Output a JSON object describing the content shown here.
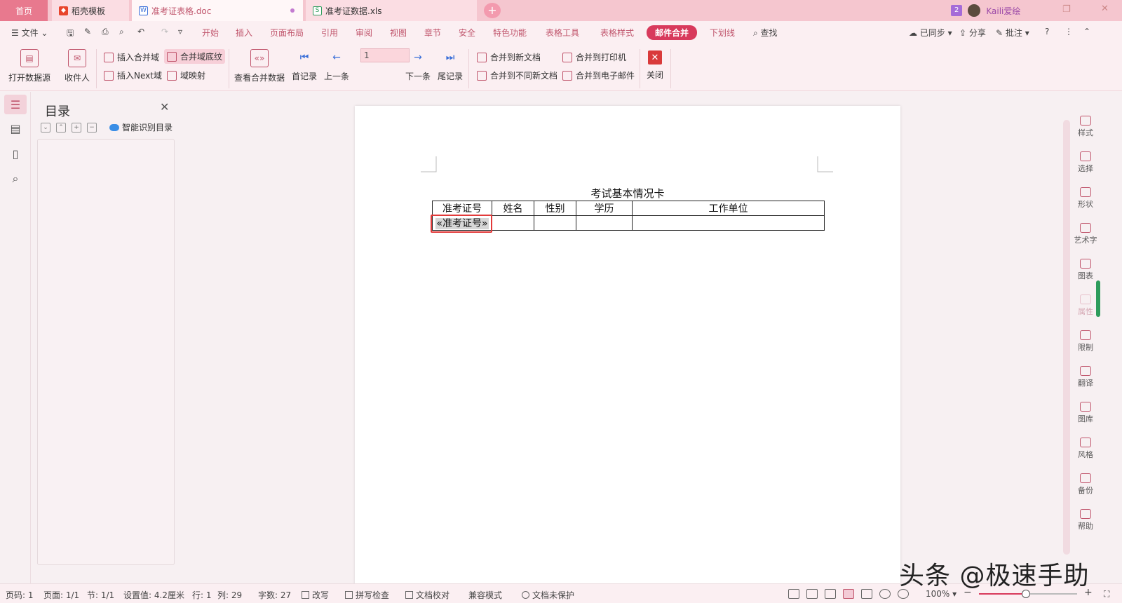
{
  "tabs": [
    {
      "label": "首页"
    },
    {
      "label": "稻壳模板"
    },
    {
      "label": "准考证表格.doc"
    },
    {
      "label": "准考证数据.xls"
    }
  ],
  "account": {
    "badge_count": "2",
    "username": "Kaili爱绘"
  },
  "menu": {
    "file": "文件",
    "tabs": [
      "开始",
      "插入",
      "页面布局",
      "引用",
      "审阅",
      "视图",
      "章节",
      "安全",
      "特色功能",
      "表格工具",
      "表格样式",
      "邮件合并",
      "下划线"
    ],
    "search": "查找",
    "right": [
      "已同步",
      "分享",
      "批注"
    ]
  },
  "ribbon": {
    "open_source": "打开数据源",
    "recipients": "收件人",
    "insert_field": "插入合并域",
    "field_shading": "合并域底纹",
    "insert_next": "插入Next域",
    "field_map": "域映射",
    "view_data": "查看合并数据",
    "first": "首记录",
    "prev": "上一条",
    "record_value": "1",
    "next": "下一条",
    "last": "尾记录",
    "to_new_doc": "合并到新文档",
    "to_diff_docs": "合并到不同新文档",
    "to_printer": "合并到打印机",
    "to_email": "合并到电子邮件",
    "close": "关闭"
  },
  "toc": {
    "title": "目录",
    "smart": "智能识别目录"
  },
  "document": {
    "title": "考试基本情况卡",
    "headers": [
      "准考证号",
      "姓名",
      "性别",
      "学历",
      "工作单位"
    ],
    "field": "«准考证号»"
  },
  "right_tools": [
    "样式",
    "选择",
    "形状",
    "艺术字",
    "图表",
    "属性",
    "限制",
    "翻译",
    "图库",
    "风格",
    "备份",
    "帮助"
  ],
  "status": {
    "page_code": "页码: 1",
    "page": "页面: 1/1",
    "section": "节: 1/1",
    "setting": "设置值: 4.2厘米",
    "row": "行: 1",
    "col": "列: 29",
    "words": "字数: 27",
    "revise": "改写",
    "spell": "拼写检查",
    "proof": "文档校对",
    "compat": "兼容模式",
    "protect": "文档未保护",
    "zoom": "100%",
    "zoom_level": 0.48
  },
  "watermark": "头条 @极速手助"
}
